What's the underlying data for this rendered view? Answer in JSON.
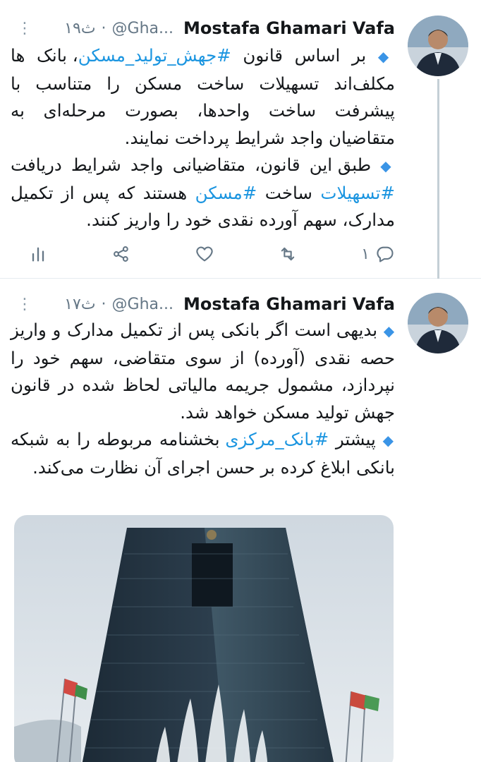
{
  "tweets": [
    {
      "author_name": "Mostafa Ghamari Vafa",
      "handle": "@Gha...",
      "time": "۱۹ث",
      "separator": "·",
      "more_icon": "vertical-ellipsis-icon",
      "paragraph1": {
        "bullet": "◆",
        "text_before": "بر اساس قانون ",
        "hashtag": "#جهش_تولید_مسکن",
        "text_after": "، بانک ها مکلف‌اند تسهیلات ساخت مسکن را متناسب با پیشرفت ساخت واحدها، بصورت مرحله‌ای به متقاضیان واجد شرایط پرداخت نمایند."
      },
      "paragraph2": {
        "bullet": "◆",
        "text_before": "طبق این قانون، متقاضیانی واجد شرایط دریافت ",
        "hashtag1": "#تسهیلات",
        "text_middle": " ساخت ",
        "hashtag2": "#مسکن",
        "text_after": " هستند که پس از تکمیل مدارک، سهم آورده نقدی خود را واریز کنند."
      },
      "actions": {
        "reply_count": "۱",
        "reply_icon": "reply-icon",
        "retweet_icon": "retweet-icon",
        "like_icon": "heart-icon",
        "share_icon": "share-icon",
        "analytics_icon": "analytics-icon"
      }
    },
    {
      "author_name": "Mostafa Ghamari Vafa",
      "handle": "@Gha...",
      "time": "۱۷ث",
      "separator": "·",
      "more_icon": "vertical-ellipsis-icon",
      "paragraph1": {
        "bullet": "◆",
        "text": "بدیهی است اگر بانکی پس از تکمیل مدارک و واریز حصه نقدی (آورده) از سوی متقاضی، سهم خود را نپردازد، مشمول جریمه مالیاتی لحاظ شده در قانون جهش تولید مسکن خواهد شد."
      },
      "paragraph2": {
        "bullet": "◆",
        "text_before": "پیشتر ",
        "hashtag": "#بانک_مرکزی",
        "text_after": " بخشنامه مربوطه را به شبکه بانکی ابلاغ کرده بر حسن اجرای آن نظارت می‌کند."
      },
      "image": "central-bank-building-photo"
    }
  ],
  "colors": {
    "link": "#1b95e0",
    "muted": "#657786",
    "bullet": "#3a94e6"
  }
}
